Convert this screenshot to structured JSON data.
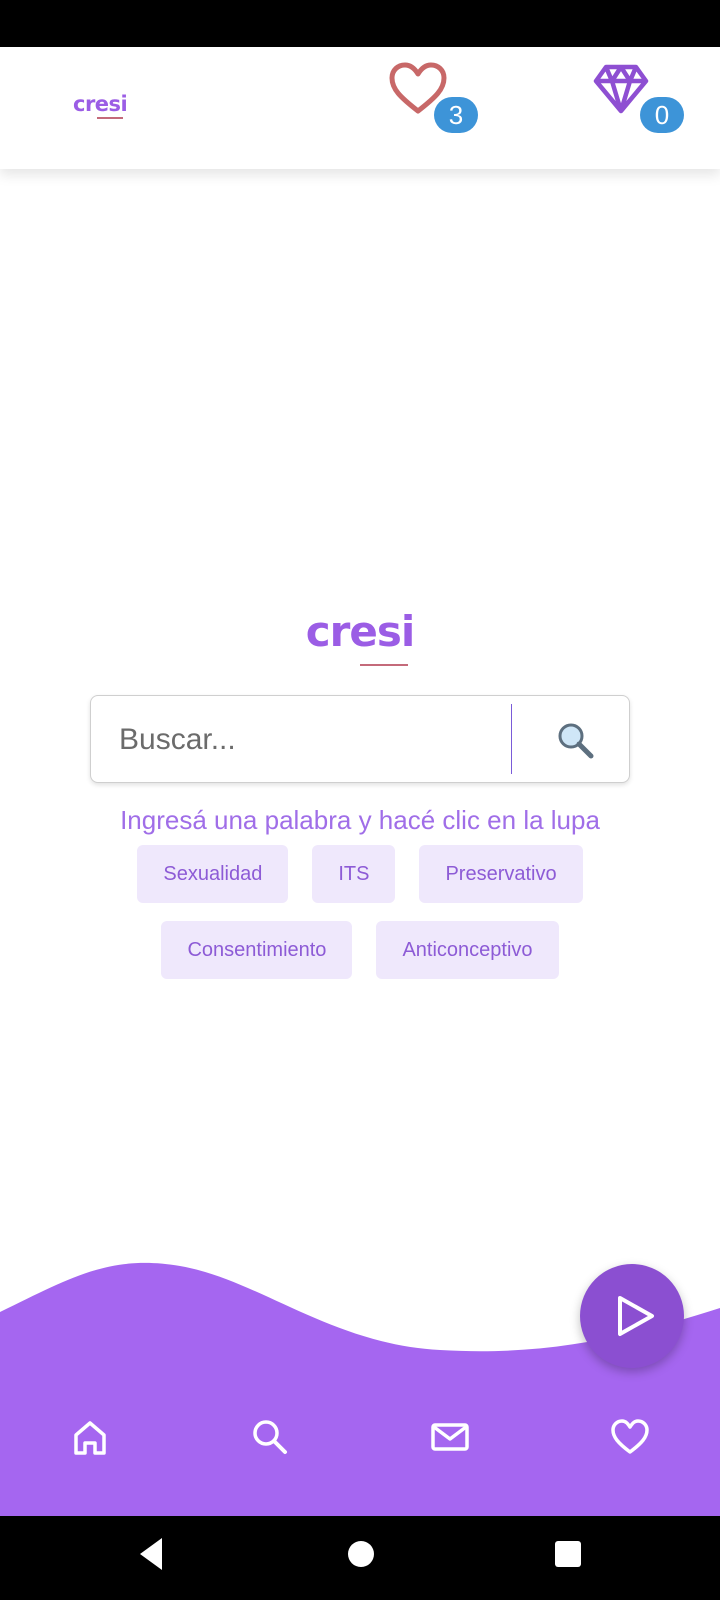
{
  "header": {
    "brand": "cresi",
    "likes_count": "3",
    "gems_count": "0"
  },
  "main": {
    "brand": "cresi",
    "search": {
      "placeholder": "Buscar...",
      "value": ""
    },
    "hint": "Ingresá una palabra y hacé clic en la lupa",
    "chips": [
      "Sexualidad",
      "ITS",
      "Preservativo",
      "Consentimiento",
      "Anticonceptivo"
    ]
  },
  "bottom_nav": {
    "items": [
      "home-icon",
      "search-icon",
      "mail-icon",
      "heart-icon"
    ]
  },
  "colors": {
    "accent": "#9b5de5",
    "wave": "#a566f0",
    "fab": "#8b4fd1",
    "badge": "#3d94d8",
    "heart": "#c86868",
    "chip_bg": "#efe8fc"
  }
}
